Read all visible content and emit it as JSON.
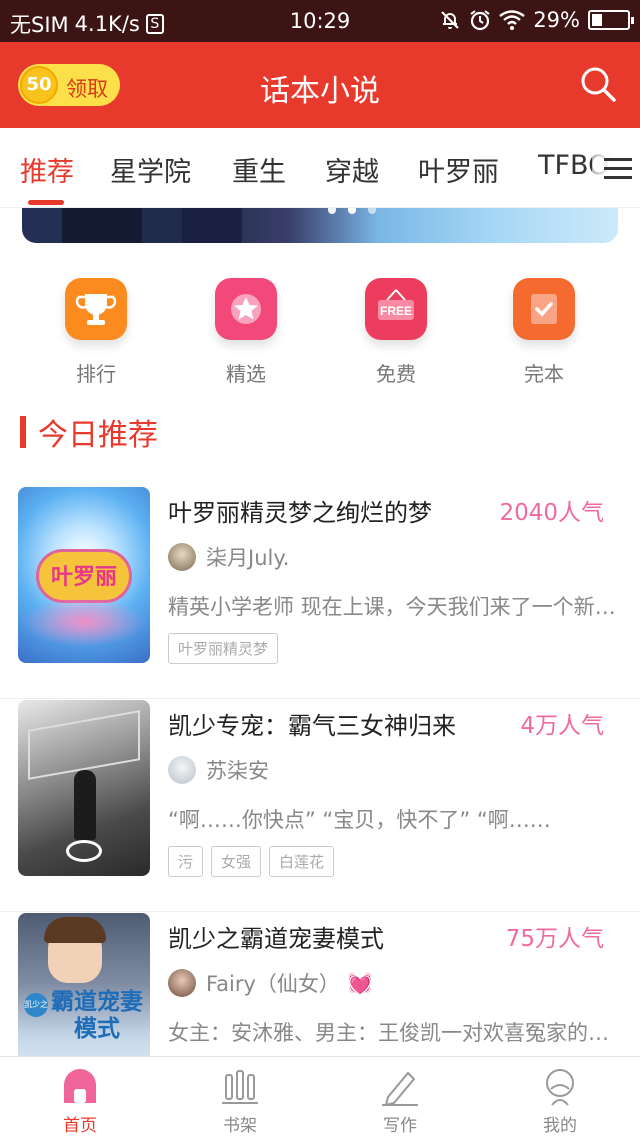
{
  "status_bar": {
    "carrier": "无SIM",
    "speed": "4.1K/s",
    "sim_icon_text": "S",
    "time": "10:29",
    "battery": "29%",
    "battery_level": 0.29,
    "icons": [
      "sim-card-icon",
      "do-not-disturb-icon",
      "alarm-icon",
      "wifi-icon",
      "battery-icon"
    ]
  },
  "header": {
    "coin_value": "50",
    "claim_label": "领取",
    "title": "话本小说",
    "search_icon": "search-icon"
  },
  "tabs": {
    "items": [
      {
        "label": "推荐",
        "active": true
      },
      {
        "label": "星学院",
        "active": false
      },
      {
        "label": "重生",
        "active": false
      },
      {
        "label": "穿越",
        "active": false
      },
      {
        "label": "叶罗丽",
        "active": false
      },
      {
        "label": "TFBOYS",
        "active": false
      }
    ],
    "menu_icon": "menu-icon"
  },
  "categories": [
    {
      "label": "排行",
      "icon": "trophy-icon",
      "color": "#fb8a1f"
    },
    {
      "label": "精选",
      "icon": "star-icon",
      "color": "#f2487a"
    },
    {
      "label": "免费",
      "icon": "free-sign-icon",
      "color": "#ec3d5e"
    },
    {
      "label": "完本",
      "icon": "check-book-icon",
      "color": "#f56a2e"
    }
  ],
  "section": {
    "title": "今日推荐"
  },
  "books": [
    {
      "title": "叶罗丽精灵梦之绚烂的梦",
      "popularity": "2040人气",
      "author": "柒月July.",
      "description": "精英小学老师 现在上课，今天我们来了一个新同学",
      "tags": [
        "叶罗丽精灵梦"
      ],
      "cover_text": "叶罗丽"
    },
    {
      "title": "凯少专宠：霸气三女神归来",
      "popularity": "4万人气",
      "author": "苏柒安",
      "description": "“啊……你快点” “宝贝，快不了” “啊……",
      "tags": [
        "污",
        "女强",
        "白莲花"
      ],
      "cover_text": ""
    },
    {
      "title": "凯少之霸道宠妻模式",
      "popularity": "75万人气",
      "author": "Fairy（仙女）",
      "author_badge": "💓",
      "description": "女主：安沐雅、男主：王俊凯一对欢喜冤家的故事",
      "tags": [],
      "cover_text": "霸道宠妻模式",
      "cover_badge": "凯少之"
    }
  ],
  "bottom_nav": [
    {
      "label": "首页",
      "icon": "home-icon",
      "active": true
    },
    {
      "label": "书架",
      "icon": "bookshelf-icon",
      "active": false
    },
    {
      "label": "写作",
      "icon": "pencil-icon",
      "active": false
    },
    {
      "label": "我的",
      "icon": "profile-icon",
      "active": false
    }
  ],
  "colors": {
    "brand_red": "#e83a2c",
    "popularity_pink": "#f06aa0",
    "status_bar": "#3d1414"
  }
}
